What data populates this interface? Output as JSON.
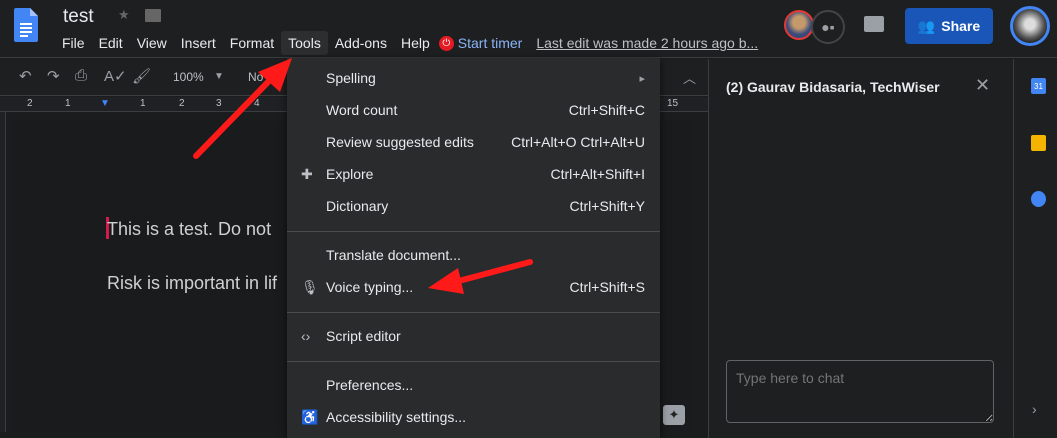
{
  "header": {
    "title": "test",
    "menu": [
      "File",
      "Edit",
      "View",
      "Insert",
      "Format",
      "Tools",
      "Add-ons",
      "Help"
    ],
    "timer": "Start timer",
    "last_edit": "Last edit was made 2 hours ago b...",
    "share": "Share"
  },
  "toolbar": {
    "zoom": "100%",
    "style": "No"
  },
  "ruler": [
    "2",
    "1",
    "1",
    "2",
    "3",
    "4",
    "15"
  ],
  "document": {
    "lines": [
      "This is a test. Do not",
      "Risk is important in lif"
    ]
  },
  "tools_menu": {
    "items": [
      {
        "label": "Spelling",
        "shortcut": "▸",
        "icon": ""
      },
      {
        "label": "Word count",
        "shortcut": "Ctrl+Shift+C",
        "icon": ""
      },
      {
        "label": "Review suggested edits",
        "shortcut": "Ctrl+Alt+O Ctrl+Alt+U",
        "icon": ""
      },
      {
        "label": "Explore",
        "shortcut": "Ctrl+Alt+Shift+I",
        "icon": "explore-icon"
      },
      {
        "label": "Dictionary",
        "shortcut": "Ctrl+Shift+Y",
        "icon": ""
      },
      {
        "label": "Translate document...",
        "shortcut": "",
        "icon": ""
      },
      {
        "label": "Voice typing...",
        "shortcut": "Ctrl+Shift+S",
        "icon": "microphone-icon"
      },
      {
        "label": "Script editor",
        "shortcut": "",
        "icon": "code-icon"
      },
      {
        "label": "Preferences...",
        "shortcut": "",
        "icon": ""
      },
      {
        "label": "Accessibility settings...",
        "shortcut": "",
        "icon": "accessibility-icon"
      }
    ]
  },
  "chat": {
    "title": "(2) Gaurav Bidasaria, TechWiser",
    "placeholder": "Type here to chat"
  },
  "sidebar": {
    "calendar_day": "31"
  },
  "colors": {
    "share": "#1a56b8",
    "accent": "#8ab4f8",
    "annotation": "#ff1a1a"
  }
}
